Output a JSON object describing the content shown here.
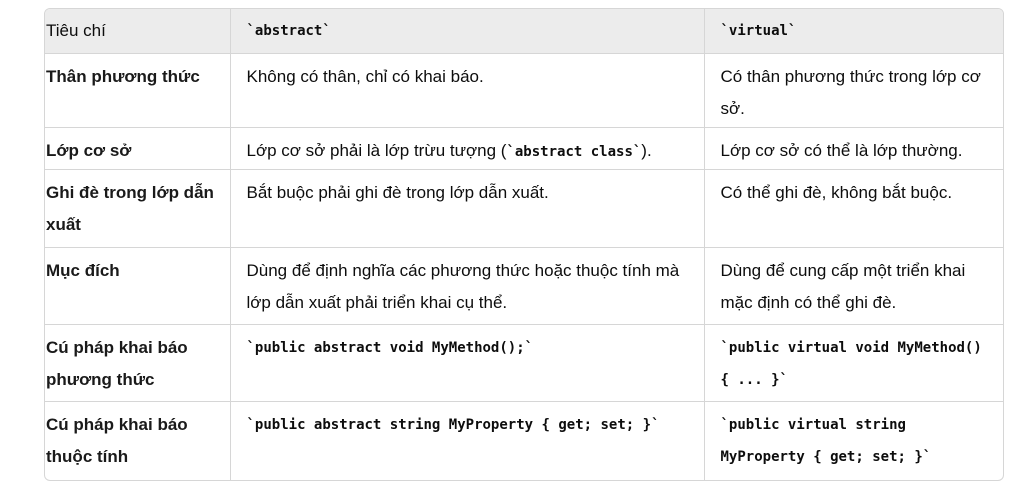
{
  "header": {
    "criteria": "Tiêu chí",
    "abstract": "`abstract`",
    "virtual": "`virtual`"
  },
  "rows": [
    {
      "criterion": "Thân phương thức",
      "abstract": "Không có thân, chỉ có khai báo.",
      "virtual": "Có thân phương thức trong lớp cơ sở."
    },
    {
      "criterion": "Lớp cơ sở",
      "abstract_pre": "Lớp cơ sở phải là lớp trừu tượng (",
      "abstract_code": "`abstract class`",
      "abstract_post": ").",
      "virtual": "Lớp cơ sở có thể là lớp thường."
    },
    {
      "criterion": "Ghi đè trong lớp dẫn xuất",
      "abstract": "Bắt buộc phải ghi đè trong lớp dẫn xuất.",
      "virtual": "Có thể ghi đè, không bắt buộc."
    },
    {
      "criterion": "Mục đích",
      "abstract": "Dùng để định nghĩa các phương thức hoặc thuộc tính mà lớp dẫn xuất phải triển khai cụ thể.",
      "virtual": "Dùng để cung cấp một triển khai mặc định có thể ghi đè."
    },
    {
      "criterion": "Cú pháp khai báo phương thức",
      "abstract": "`public abstract void MyMethod();`",
      "virtual": "`public virtual void MyMethod() { ... }`"
    },
    {
      "criterion": "Cú pháp khai báo thuộc tính",
      "abstract": "`public abstract string MyProperty { get; set; }`",
      "virtual": "`public virtual string MyProperty { get; set; }`"
    }
  ]
}
